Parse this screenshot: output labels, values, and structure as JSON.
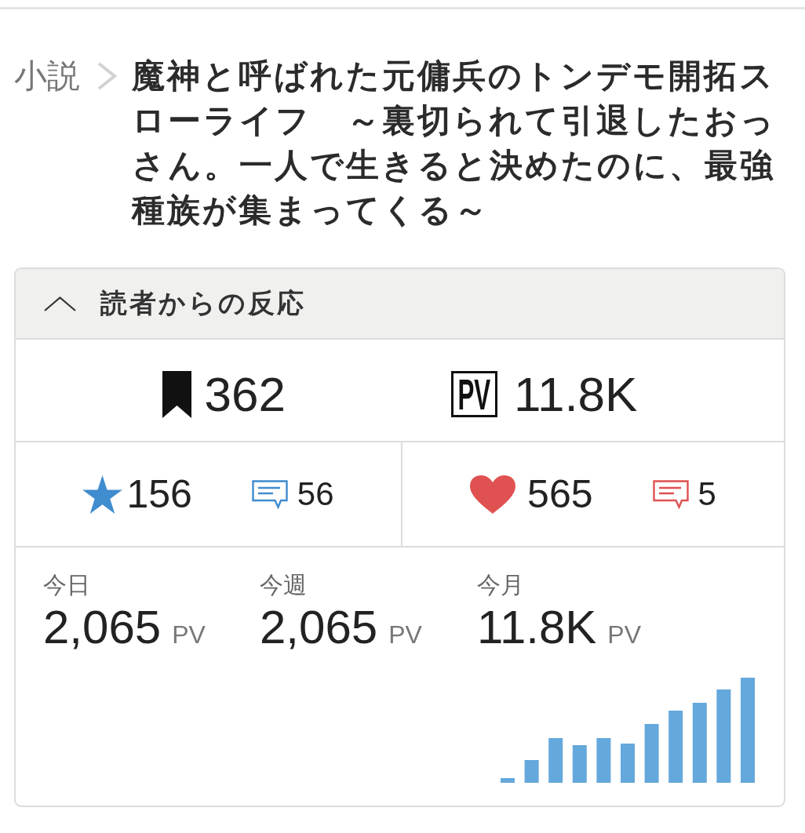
{
  "breadcrumb": {
    "category": "小説",
    "title": "魔神と呼ばれた元傭兵のトンデモ開拓スローライフ　～裏切られて引退したおっさん。一人で生きると決めたのに、最強種族が集まってくる～"
  },
  "reactions_panel": {
    "title": "読者からの反応",
    "expanded": true,
    "totals": [
      {
        "kind": "bookmarks",
        "value": "362"
      },
      {
        "kind": "pv",
        "badge": "PV",
        "value": "11.8K"
      }
    ],
    "ratings": [
      {
        "kind": "stars",
        "count": "156",
        "comments": "56",
        "color": "#3f8ccf"
      },
      {
        "kind": "hearts",
        "count": "565",
        "comments": "5",
        "color": "#e05151"
      }
    ],
    "periods": [
      {
        "label": "今日",
        "value": "2,065",
        "unit": "PV"
      },
      {
        "label": "今週",
        "value": "2,065",
        "unit": "PV"
      },
      {
        "label": "今月",
        "value": "11.8K",
        "unit": "PV"
      }
    ]
  }
}
